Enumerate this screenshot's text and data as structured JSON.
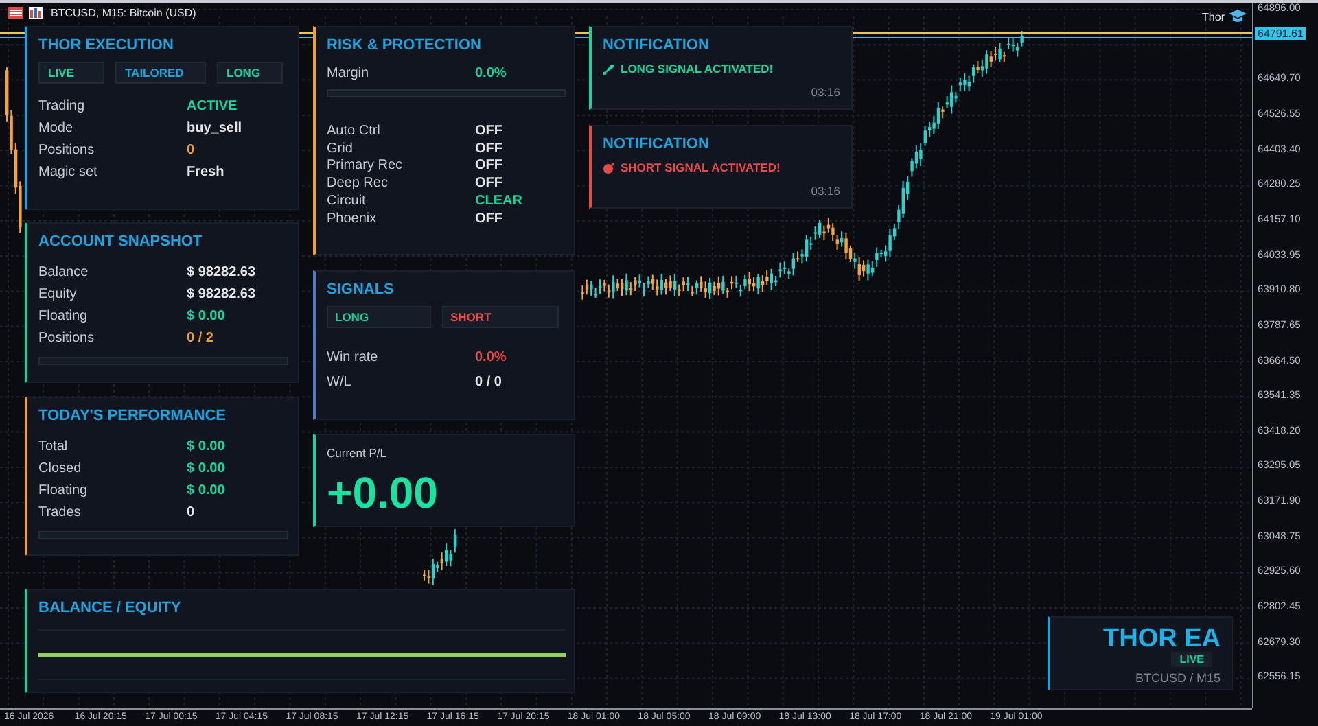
{
  "window": {
    "title": "BTCUSD, M15: Bitcoin (USD)",
    "ea_label": "Thor"
  },
  "price_axis": {
    "current_price": "64791.61",
    "labels": [
      "64896.00",
      "64649.70",
      "64526.55",
      "64403.40",
      "64280.25",
      "64157.10",
      "64033.95",
      "63910.80",
      "63787.65",
      "63664.50",
      "63541.35",
      "63418.20",
      "63295.05",
      "63171.90",
      "63048.75",
      "62925.60",
      "62802.45",
      "62679.30",
      "62556.15"
    ]
  },
  "time_axis": {
    "labels": [
      "16 Jul 2026",
      "16 Jul 20:15",
      "17 Jul 00:15",
      "17 Jul 04:15",
      "17 Jul 08:15",
      "17 Jul 12:15",
      "17 Jul 16:15",
      "17 Jul 20:15",
      "18 Jul 01:00",
      "18 Jul 05:00",
      "18 Jul 09:00",
      "18 Jul 13:00",
      "18 Jul 17:00",
      "18 Jul 21:00",
      "19 Jul 01:00"
    ]
  },
  "execution_panel": {
    "title": "THOR EXECUTION",
    "tags": [
      {
        "label": "LIVE",
        "color": "#19d39a"
      },
      {
        "label": "TAILORED",
        "color": "#1fa3dc"
      },
      {
        "label": "LONG",
        "color": "#19d39a"
      }
    ],
    "rows": [
      {
        "label": "Trading",
        "value": "ACTIVE",
        "color": "#19d39a"
      },
      {
        "label": "Mode",
        "value": "buy_sell",
        "color": "#e6e6e6"
      },
      {
        "label": "Positions",
        "value": "0",
        "color": "#f0a030"
      },
      {
        "label": "Magic set",
        "value": "Fresh",
        "color": "#e6e6e6"
      }
    ]
  },
  "risk_panel": {
    "title": "RISK & PROTECTION",
    "margin": {
      "label": "Margin",
      "value": "0.0%",
      "level": 0
    },
    "rows": [
      {
        "label": "Auto Ctrl",
        "value": "OFF",
        "color": "#e6e6e6"
      },
      {
        "label": "Grid",
        "value": "OFF",
        "color": "#e6e6e6"
      },
      {
        "label": "Primary Rec",
        "value": "OFF",
        "color": "#e6e6e6"
      },
      {
        "label": "Deep Rec",
        "value": "OFF",
        "color": "#e6e6e6"
      },
      {
        "label": "Circuit",
        "value": "CLEAR",
        "color": "#19d39a"
      },
      {
        "label": "Phoenix",
        "value": "OFF",
        "color": "#e6e6e6"
      }
    ]
  },
  "account_panel": {
    "title": "ACCOUNT SNAPSHOT",
    "level": 0,
    "rows": [
      {
        "label": "Balance",
        "value": "$ 98282.63",
        "color": "#e6e6e6"
      },
      {
        "label": "Equity",
        "value": "$ 98282.63",
        "color": "#e6e6e6"
      },
      {
        "label": "Floating",
        "value": "$ 0.00",
        "color": "#19d39a"
      },
      {
        "label": "Positions",
        "value": "0 / 2",
        "color": "#f0a030"
      }
    ]
  },
  "signals_panel": {
    "title": "SIGNALS",
    "signals": [
      {
        "label": "LONG",
        "color": "#19d39a"
      },
      {
        "label": "SHORT",
        "color": "#e84a4a"
      }
    ],
    "rows": [
      {
        "label": "Win rate",
        "value": "0.0%",
        "color": "#e84a4a"
      },
      {
        "label": "W/L",
        "value": "0 / 0",
        "color": "#e6e6e6"
      }
    ]
  },
  "performance_panel": {
    "title": "TODAY'S PERFORMANCE",
    "level": 0,
    "rows": [
      {
        "label": "Total",
        "value": "$ 0.00",
        "color": "#19d39a"
      },
      {
        "label": "Closed",
        "value": "$ 0.00",
        "color": "#19d39a"
      },
      {
        "label": "Floating",
        "value": "$ 0.00",
        "color": "#19d39a"
      },
      {
        "label": "Trades",
        "value": "0",
        "color": "#e6e6e6"
      }
    ]
  },
  "pl_panel": {
    "label": "Current P/L",
    "value": "+0.00"
  },
  "balance_panel": {
    "title": "BALANCE / EQUITY"
  },
  "notifications": [
    {
      "title": "NOTIFICATION",
      "kind": "long",
      "message": "LONG SIGNAL ACTIVATED!",
      "time": "03:16",
      "color": "#19d39a"
    },
    {
      "title": "NOTIFICATION",
      "kind": "short",
      "message": "SHORT SIGNAL ACTIVATED!",
      "time": "03:16",
      "color": "#e84a4a"
    }
  ],
  "badge": {
    "title": "THOR EA",
    "status": "LIVE",
    "symbol": "BTCUSD / M15"
  }
}
